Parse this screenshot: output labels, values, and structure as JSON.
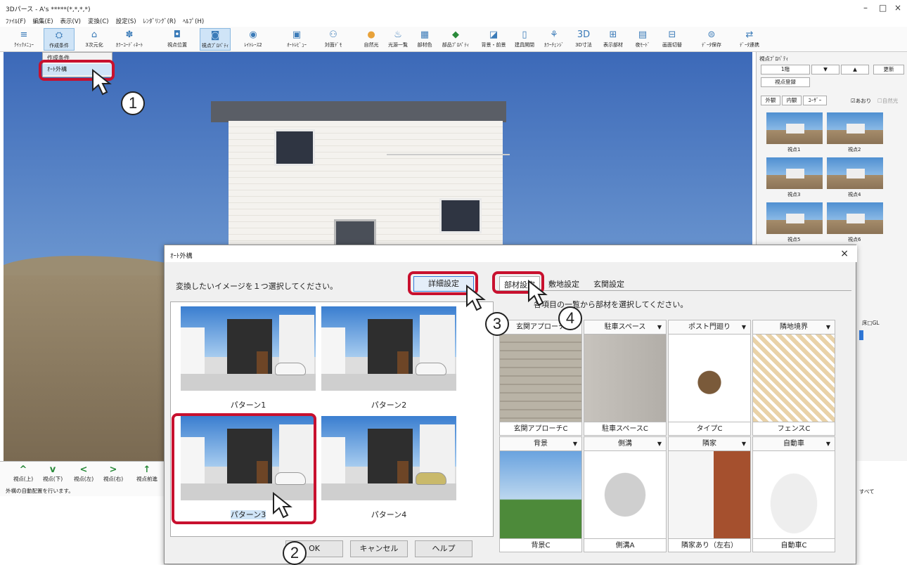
{
  "window": {
    "title": "3Dパース - A's *****(*,*,*,*)",
    "min": "–",
    "max": "□",
    "close": "×"
  },
  "menu": [
    "ﾌｧｲﾙ(F)",
    "編集(E)",
    "表示(V)",
    "変換(C)",
    "設定(S)",
    "ﾚﾝﾀﾞﾘﾝｸﾞ(R)",
    "ﾍﾙﾌﾟ(H)"
  ],
  "toolbar": [
    "ｸｲｯｸﾒﾆｭｰ",
    "作成条件",
    "3次元化",
    "ｶﾗｰｺｰﾃﾞｨﾈｰﾄ",
    "視点位置",
    "視点ﾌﾟﾛﾊﾟﾃｨ",
    "ﾚｲﾄﾚｰｽ2",
    "ｵｰﾄﾚﾋﾞｭｰ",
    "対面ﾃﾞﾓ",
    "自然光",
    "光源一覧",
    "部材色",
    "部品ﾌﾟﾛﾊﾟﾃｨ",
    "背景・前景",
    "建具開閉",
    "ｶﾗｰﾁｪﾝｼﾞ",
    "3D寸法",
    "表示部材",
    "夜ﾓｰﾄﾞ",
    "画面切替",
    "ﾃﾞｰﾀ保存",
    "ﾃﾞｰﾀ連携"
  ],
  "dropdown": {
    "item1": "作成条件",
    "item2": "ｵｰﾄ外構"
  },
  "rightpanel": {
    "title": "視点ﾌﾟﾛﾊﾟﾃｨ",
    "floor": "1階",
    "down": "▼",
    "up": "▲",
    "update": "更新",
    "register": "視点登録",
    "tab1": "外観",
    "tab2": "内観",
    "tab3": "ﾕｰｻﾞｰ",
    "chk1": "☑あおり",
    "chk2": "☐自然光",
    "thumbs": [
      "視点1",
      "視点2",
      "視点3",
      "視点4",
      "視点5",
      "視点6"
    ]
  },
  "bottombar": {
    "nav": [
      "視点(上)",
      "視点(下)",
      "視点(左)",
      "視点(右)",
      "視点前進"
    ],
    "status": "外構の自動配置を行います。"
  },
  "dialog": {
    "title": "ｵｰﾄ外構",
    "instruction": "変換したいイメージを１つ選択してください。",
    "detail": "詳細設定",
    "patterns": [
      "パターン1",
      "パターン2",
      "パターン3",
      "パターン4"
    ],
    "ok": "OK",
    "cancel": "キャンセル",
    "help": "ヘルプ",
    "tabs": [
      "部材設定",
      "敷地設定",
      "玄関設定"
    ],
    "select_instr": "各項目の一覧から部材を選択してください。",
    "cells": [
      {
        "h": "玄関アプローチ",
        "f": "玄関アプローチC"
      },
      {
        "h": "駐車スペース",
        "f": "駐車スペースC"
      },
      {
        "h": "ポスト門廻り",
        "f": "タイプC"
      },
      {
        "h": "隣地境界",
        "f": "フェンスC"
      },
      {
        "h": "背景",
        "f": "背景C"
      },
      {
        "h": "側溝",
        "f": "側溝A"
      },
      {
        "h": "隣家",
        "f": "隣家あり（左右）"
      },
      {
        "h": "自動車",
        "f": "自動車C"
      }
    ]
  },
  "callouts": [
    "1",
    "2",
    "3",
    "4"
  ],
  "right_fragments": {
    "gl": "床□GL",
    "all": "すべて"
  },
  "colors": {
    "accent": "#c8102e",
    "select": "#cfe4f7"
  }
}
